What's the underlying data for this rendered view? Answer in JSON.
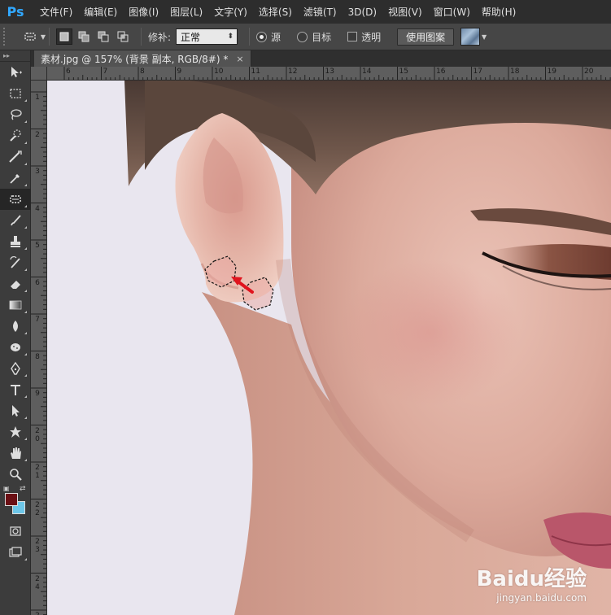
{
  "app": {
    "logo": "Ps"
  },
  "menu": [
    "文件(F)",
    "编辑(E)",
    "图像(I)",
    "图层(L)",
    "文字(Y)",
    "选择(S)",
    "滤镜(T)",
    "3D(D)",
    "视图(V)",
    "窗口(W)",
    "帮助(H)"
  ],
  "options": {
    "patch_label": "修补:",
    "patch_mode": "正常",
    "source_label": "源",
    "target_label": "目标",
    "transparent_label": "透明",
    "use_pattern_label": "使用图案"
  },
  "document": {
    "tab_title": "素材.jpg @ 157% (背景 副本, RGB/8#) *",
    "close_glyph": "×"
  },
  "rulers": {
    "top": [
      "6",
      "7",
      "8",
      "9",
      "10",
      "11",
      "12",
      "13",
      "14",
      "15",
      "16",
      "17",
      "18",
      "19",
      "20"
    ],
    "left": [
      "1",
      "2",
      "3",
      "4",
      "5",
      "6",
      "7",
      "8",
      "9",
      "20",
      "21",
      "22",
      "23",
      "24",
      "25"
    ]
  },
  "colors": {
    "foreground": "#6b0f14",
    "background": "#6dc6e8",
    "arrow": "#e0141e"
  },
  "watermark": {
    "title": "Baidu经验",
    "url": "jingyan.baidu.com"
  }
}
